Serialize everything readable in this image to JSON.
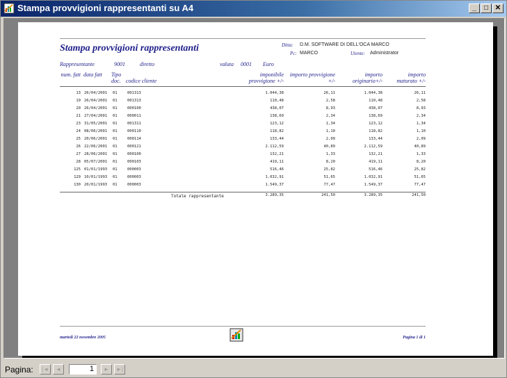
{
  "window": {
    "title": "Stampa provvigioni rappresentanti su A4",
    "min_label": "_",
    "max_label": "□",
    "close_label": "✕"
  },
  "report": {
    "title": "Stampa provvigioni rappresentanti",
    "ditta_label": "Ditta:",
    "ditta_value": "D.M. SOFTWARE DI DELL'OCA MARCO",
    "pc_label": "Pc:",
    "pc_value": "MARCO",
    "utente_label": "Utente:",
    "utente_value": "Administrator",
    "rappresentante_label": "Rappresentante",
    "rappresentante_code": "9001",
    "rappresentante_name": "diretto",
    "valuta_label": "valuta",
    "valuta_code": "0001",
    "valuta_name": "Euro",
    "headers": {
      "num_fatt": "num. fatt",
      "data_fatt": "data fatt",
      "tipo_doc": "Tipo doc.",
      "codice_cliente": "codice cliente",
      "imponibile": "imponibile provvigione +/-",
      "importo_provvigione": "importo provvigione +/-",
      "importo_originario": "importo originario+/-",
      "importo_maturato": "importo maturato +/-"
    },
    "rows": [
      {
        "num": "13",
        "date": "26/04/2001",
        "tipo": "01",
        "cliente": "001313",
        "imponibile": "1.044,38",
        "provvigione": "26,11",
        "originario": "1.044,38",
        "maturato": "26,11"
      },
      {
        "num": "19",
        "date": "26/04/2001",
        "tipo": "01",
        "cliente": "001313",
        "imponibile": "110,48",
        "provvigione": "2,58",
        "originario": "110,48",
        "maturato": "2,58"
      },
      {
        "num": "20",
        "date": "26/04/2001",
        "tipo": "01",
        "cliente": "000100",
        "imponibile": "438,07",
        "provvigione": "8,93",
        "originario": "438,07",
        "maturato": "8,93"
      },
      {
        "num": "21",
        "date": "27/04/2001",
        "tipo": "01",
        "cliente": "000011",
        "imponibile": "138,69",
        "provvigione": "2,34",
        "originario": "138,69",
        "maturato": "2,34"
      },
      {
        "num": "23",
        "date": "31/05/2001",
        "tipo": "01",
        "cliente": "001311",
        "imponibile": "123,12",
        "provvigione": "1,34",
        "originario": "123,12",
        "maturato": "1,34"
      },
      {
        "num": "24",
        "date": "08/06/2001",
        "tipo": "01",
        "cliente": "000110",
        "imponibile": "118,82",
        "provvigione": "1,10",
        "originario": "118,82",
        "maturato": "1,10"
      },
      {
        "num": "25",
        "date": "20/06/2001",
        "tipo": "01",
        "cliente": "000114",
        "imponibile": "133,44",
        "provvigione": "2,09",
        "originario": "133,44",
        "maturato": "2,09"
      },
      {
        "num": "26",
        "date": "22/06/2001",
        "tipo": "01",
        "cliente": "000121",
        "imponibile": "2.112,59",
        "provvigione": "40,89",
        "originario": "2.112,59",
        "maturato": "40,89"
      },
      {
        "num": "27",
        "date": "28/06/2001",
        "tipo": "01",
        "cliente": "000100",
        "imponibile": "132,21",
        "provvigione": "1,33",
        "originario": "132,21",
        "maturato": "1,33"
      },
      {
        "num": "28",
        "date": "05/07/2001",
        "tipo": "01",
        "cliente": "000103",
        "imponibile": "419,11",
        "provvigione": "8,20",
        "originario": "419,11",
        "maturato": "8,20"
      },
      {
        "num": "125",
        "date": "01/01/1993",
        "tipo": "01",
        "cliente": "000003",
        "imponibile": "516,46",
        "provvigione": "25,82",
        "originario": "516,46",
        "maturato": "25,82"
      },
      {
        "num": "129",
        "date": "10/01/1993",
        "tipo": "01",
        "cliente": "000003",
        "imponibile": "1.032,91",
        "provvigione": "51,65",
        "originario": "1.032,91",
        "maturato": "51,65"
      },
      {
        "num": "130",
        "date": "20/01/1993",
        "tipo": "01",
        "cliente": "000003",
        "imponibile": "1.549,37",
        "provvigione": "77,47",
        "originario": "1.549,37",
        "maturato": "77,47"
      }
    ],
    "total_label": "Totale rappresentante",
    "total": {
      "imponibile": "3.289,35",
      "provvigione": "241,50",
      "originario": "3.289,35",
      "maturato": "241,50"
    },
    "footer_date": "martedì 22 novembre 2005",
    "footer_page": "Pagina 1 di 1"
  },
  "statusbar": {
    "pagina_label": "Pagina:",
    "page_number": "1",
    "first_btn": "|◄",
    "prev_btn": "◄",
    "next_btn": "►",
    "last_btn": "►|"
  }
}
